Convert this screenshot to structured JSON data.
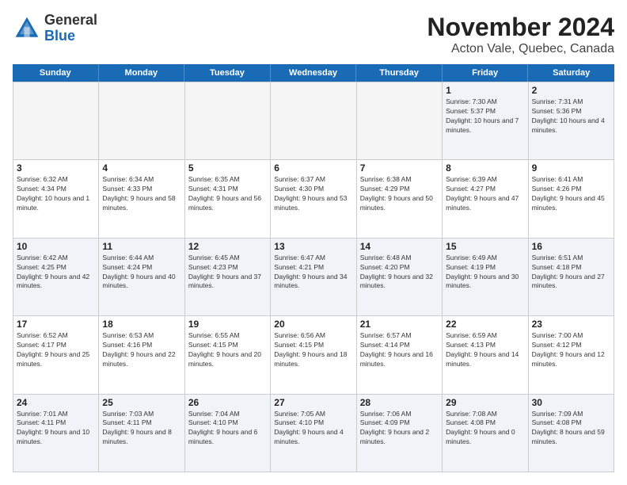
{
  "header": {
    "logo_general": "General",
    "logo_blue": "Blue",
    "title": "November 2024",
    "subtitle": "Acton Vale, Quebec, Canada"
  },
  "days_of_week": [
    "Sunday",
    "Monday",
    "Tuesday",
    "Wednesday",
    "Thursday",
    "Friday",
    "Saturday"
  ],
  "weeks": [
    [
      {
        "day": "",
        "info": "",
        "empty": true
      },
      {
        "day": "",
        "info": "",
        "empty": true
      },
      {
        "day": "",
        "info": "",
        "empty": true
      },
      {
        "day": "",
        "info": "",
        "empty": true
      },
      {
        "day": "",
        "info": "",
        "empty": true
      },
      {
        "day": "1",
        "info": "Sunrise: 7:30 AM\nSunset: 5:37 PM\nDaylight: 10 hours and 7 minutes."
      },
      {
        "day": "2",
        "info": "Sunrise: 7:31 AM\nSunset: 5:36 PM\nDaylight: 10 hours and 4 minutes."
      }
    ],
    [
      {
        "day": "3",
        "info": "Sunrise: 6:32 AM\nSunset: 4:34 PM\nDaylight: 10 hours and 1 minute."
      },
      {
        "day": "4",
        "info": "Sunrise: 6:34 AM\nSunset: 4:33 PM\nDaylight: 9 hours and 58 minutes."
      },
      {
        "day": "5",
        "info": "Sunrise: 6:35 AM\nSunset: 4:31 PM\nDaylight: 9 hours and 56 minutes."
      },
      {
        "day": "6",
        "info": "Sunrise: 6:37 AM\nSunset: 4:30 PM\nDaylight: 9 hours and 53 minutes."
      },
      {
        "day": "7",
        "info": "Sunrise: 6:38 AM\nSunset: 4:29 PM\nDaylight: 9 hours and 50 minutes."
      },
      {
        "day": "8",
        "info": "Sunrise: 6:39 AM\nSunset: 4:27 PM\nDaylight: 9 hours and 47 minutes."
      },
      {
        "day": "9",
        "info": "Sunrise: 6:41 AM\nSunset: 4:26 PM\nDaylight: 9 hours and 45 minutes."
      }
    ],
    [
      {
        "day": "10",
        "info": "Sunrise: 6:42 AM\nSunset: 4:25 PM\nDaylight: 9 hours and 42 minutes."
      },
      {
        "day": "11",
        "info": "Sunrise: 6:44 AM\nSunset: 4:24 PM\nDaylight: 9 hours and 40 minutes."
      },
      {
        "day": "12",
        "info": "Sunrise: 6:45 AM\nSunset: 4:23 PM\nDaylight: 9 hours and 37 minutes."
      },
      {
        "day": "13",
        "info": "Sunrise: 6:47 AM\nSunset: 4:21 PM\nDaylight: 9 hours and 34 minutes."
      },
      {
        "day": "14",
        "info": "Sunrise: 6:48 AM\nSunset: 4:20 PM\nDaylight: 9 hours and 32 minutes."
      },
      {
        "day": "15",
        "info": "Sunrise: 6:49 AM\nSunset: 4:19 PM\nDaylight: 9 hours and 30 minutes."
      },
      {
        "day": "16",
        "info": "Sunrise: 6:51 AM\nSunset: 4:18 PM\nDaylight: 9 hours and 27 minutes."
      }
    ],
    [
      {
        "day": "17",
        "info": "Sunrise: 6:52 AM\nSunset: 4:17 PM\nDaylight: 9 hours and 25 minutes."
      },
      {
        "day": "18",
        "info": "Sunrise: 6:53 AM\nSunset: 4:16 PM\nDaylight: 9 hours and 22 minutes."
      },
      {
        "day": "19",
        "info": "Sunrise: 6:55 AM\nSunset: 4:15 PM\nDaylight: 9 hours and 20 minutes."
      },
      {
        "day": "20",
        "info": "Sunrise: 6:56 AM\nSunset: 4:15 PM\nDaylight: 9 hours and 18 minutes."
      },
      {
        "day": "21",
        "info": "Sunrise: 6:57 AM\nSunset: 4:14 PM\nDaylight: 9 hours and 16 minutes."
      },
      {
        "day": "22",
        "info": "Sunrise: 6:59 AM\nSunset: 4:13 PM\nDaylight: 9 hours and 14 minutes."
      },
      {
        "day": "23",
        "info": "Sunrise: 7:00 AM\nSunset: 4:12 PM\nDaylight: 9 hours and 12 minutes."
      }
    ],
    [
      {
        "day": "24",
        "info": "Sunrise: 7:01 AM\nSunset: 4:11 PM\nDaylight: 9 hours and 10 minutes."
      },
      {
        "day": "25",
        "info": "Sunrise: 7:03 AM\nSunset: 4:11 PM\nDaylight: 9 hours and 8 minutes."
      },
      {
        "day": "26",
        "info": "Sunrise: 7:04 AM\nSunset: 4:10 PM\nDaylight: 9 hours and 6 minutes."
      },
      {
        "day": "27",
        "info": "Sunrise: 7:05 AM\nSunset: 4:10 PM\nDaylight: 9 hours and 4 minutes."
      },
      {
        "day": "28",
        "info": "Sunrise: 7:06 AM\nSunset: 4:09 PM\nDaylight: 9 hours and 2 minutes."
      },
      {
        "day": "29",
        "info": "Sunrise: 7:08 AM\nSunset: 4:08 PM\nDaylight: 9 hours and 0 minutes."
      },
      {
        "day": "30",
        "info": "Sunrise: 7:09 AM\nSunset: 4:08 PM\nDaylight: 8 hours and 59 minutes."
      }
    ]
  ]
}
